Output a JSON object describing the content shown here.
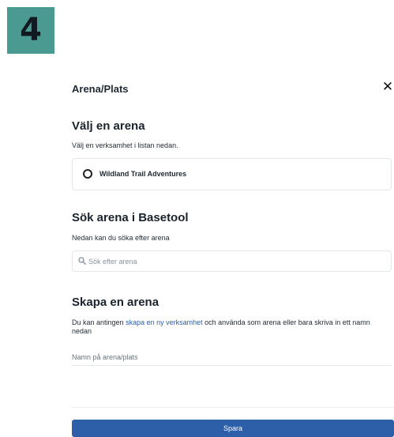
{
  "step": {
    "number": "4",
    "color": "#4a9a92"
  },
  "dialog": {
    "title": "Arena/Plats",
    "close_symbol": "✕"
  },
  "choose_arena": {
    "heading": "Välj en arena",
    "description": "Välj en verksamhet i listan nedan.",
    "options": [
      {
        "label": "Wildland Trail Adventures",
        "selected": false
      }
    ]
  },
  "search_arena": {
    "heading": "Sök arena i Basetool",
    "description": "Nedan kan du söka efter arena",
    "placeholder": "Sök efter arena",
    "icon": "search-icon"
  },
  "create_arena": {
    "heading": "Skapa en arena",
    "description_prefix": "Du kan antingen ",
    "link_text": "skapa en ny verksamhet",
    "description_suffix": " och använda som arena eller bara skriva in ett namn nedan",
    "name_placeholder": "Namn på arena/plats"
  },
  "footer": {
    "save_label": "Spara"
  },
  "colors": {
    "primary": "#2d5fa8",
    "border": "#e3e6ea",
    "text": "#1f2933"
  }
}
